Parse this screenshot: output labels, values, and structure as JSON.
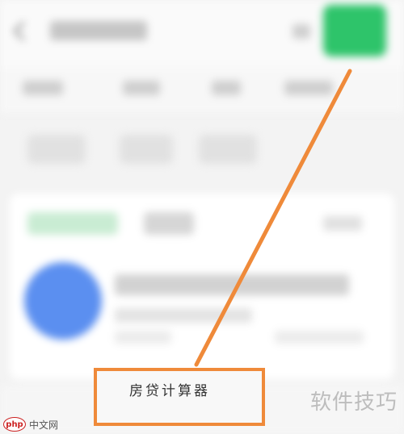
{
  "highlight": {
    "menu_item_label": "房贷计算器"
  },
  "watermark": {
    "right_text": "软件技巧",
    "logo_text": "php",
    "site_text": "中文网"
  },
  "colors": {
    "annotation_orange": "#ef8a3a",
    "search_green": "#2ec46a",
    "avatar_blue": "#5b8ff0"
  }
}
